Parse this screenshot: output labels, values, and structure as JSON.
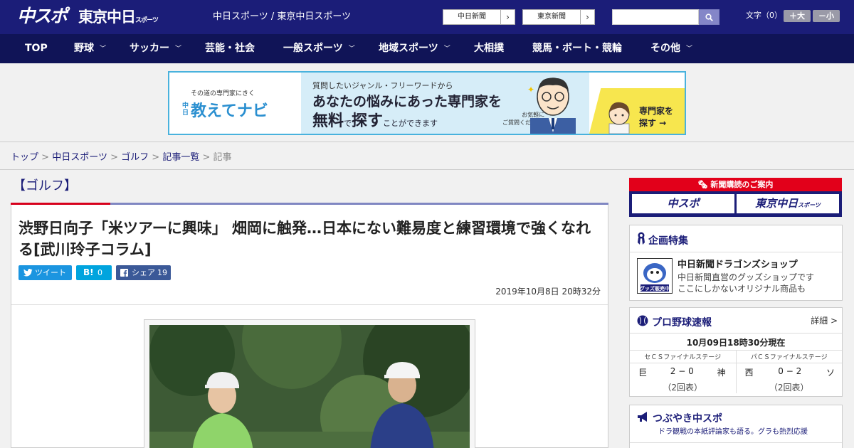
{
  "header": {
    "logo_chuspo": "中スポ",
    "logo_tokyo": "東京中日",
    "logo_tokyo_sub": "スポーツ",
    "site_links": "中日スポーツ / 東京中日スポーツ",
    "paper_buttons": [
      {
        "label": "中日新聞"
      },
      {
        "label": "東京新聞"
      }
    ],
    "search": {
      "placeholder": ""
    },
    "font_size": {
      "label": "文字（0）",
      "larger": "＋大",
      "smaller": "－小"
    }
  },
  "nav": {
    "items": [
      {
        "label": "TOP",
        "dropdown": false
      },
      {
        "label": "野球",
        "dropdown": true
      },
      {
        "label": "サッカー",
        "dropdown": true
      },
      {
        "label": "芸能・社会",
        "dropdown": false
      },
      {
        "label": "一般スポーツ",
        "dropdown": true
      },
      {
        "label": "地域スポーツ",
        "dropdown": true
      },
      {
        "label": "大相撲",
        "dropdown": false
      },
      {
        "label": "競馬・ボート・競輪",
        "dropdown": false
      },
      {
        "label": "その他",
        "dropdown": true
      }
    ]
  },
  "banner": {
    "brand_small": "その道の専門家にきく",
    "brand_prefix": "中日",
    "brand_name": "教えてナビ",
    "line1": "質問したいジャンル・フリーワードから",
    "line2": "あなたの悩みにあった専門家を",
    "line3_a": "無料",
    "line3_b": "で",
    "line3_c": "探す",
    "line3_d": "ことができます",
    "note1": "お気軽に",
    "note2": "ご質問ください!",
    "cta1": "専門家を",
    "cta2": "探す →"
  },
  "breadcrumb": {
    "items": [
      "トップ",
      "中日スポーツ",
      "ゴルフ",
      "記事一覧"
    ],
    "current": "記事",
    "separator": ">"
  },
  "article": {
    "category": "【ゴルフ】",
    "title": "渋野日向子「米ツアーに興味」 畑岡に触発…日本にない難易度と練習環境で強くなれる[武川玲子コラム]",
    "share": {
      "tweet": "ツイート",
      "hatena_label": "B!",
      "hatena_count": "0",
      "fb_label": "シェア",
      "fb_count": "19"
    },
    "date": "2019年10月8日 20時32分"
  },
  "sidebar": {
    "subscription": {
      "header": "新聞購読のご案内",
      "buttons": [
        "中スポ",
        "東京中日"
      ],
      "button_sub": "スポーツ"
    },
    "special": {
      "title": "企画特集",
      "item_title": "中日新聞ドラゴンズショップ",
      "item_desc1": "中日新聞直営のグッズショップです",
      "item_desc2": "ここにしかないオリジナル商品も",
      "thumb_label": "グッズ販売中"
    },
    "baseball": {
      "title": "プロ野球速報",
      "detail": "詳細 >",
      "time": "10月09日18時30分現在",
      "games": [
        {
          "stage": "セＣＳファイナルステージ",
          "home": "巨",
          "score": "2 − 0",
          "away": "神",
          "note": "（2回表）"
        },
        {
          "stage": "パＣＳファイナルステージ",
          "home": "西",
          "score": "0 − 2",
          "away": "ソ",
          "note": "（2回表）"
        }
      ]
    },
    "tweets": {
      "title": "つぶやき中スポ",
      "desc": "ドラ観戦の本紙評論家も語る。グラも熱烈応援"
    }
  }
}
